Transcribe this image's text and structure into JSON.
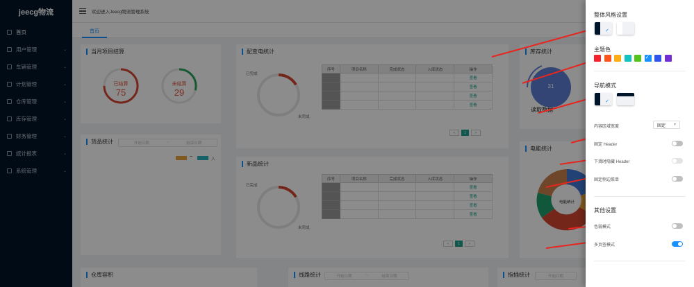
{
  "app": {
    "logo": "jeecg物流"
  },
  "header": {
    "welcome": "欢迎进入Jeecg物流管理系统"
  },
  "tabs": [
    {
      "label": "首页"
    }
  ],
  "sidebar": {
    "items": [
      {
        "label": "首页",
        "arrow": ""
      },
      {
        "label": "用户管理",
        "arrow": "⌄"
      },
      {
        "label": "车辆管理",
        "arrow": "⌄"
      },
      {
        "label": "计划管理",
        "arrow": "⌄"
      },
      {
        "label": "仓库管理",
        "arrow": "⌄"
      },
      {
        "label": "库存管理",
        "arrow": "⌄"
      },
      {
        "label": "财务管理",
        "arrow": "⌄"
      },
      {
        "label": "统计报表",
        "arrow": "⌄"
      },
      {
        "label": "系统管理",
        "arrow": "⌄"
      }
    ]
  },
  "dashboard": {
    "monthly": {
      "title": "当月项目结算",
      "settled_label": "已结算",
      "settled_value": "75",
      "unsettled_label": "未结算",
      "unsettled_value": "29"
    },
    "delivery": {
      "title": "配变电统计",
      "done_label": "已完成",
      "undone_label": "未完成",
      "columns": [
        "序号",
        "项目名称",
        "完成状态",
        "入库状态",
        "操作"
      ],
      "rows": [
        {
          "action": "查看"
        },
        {
          "action": "查看"
        },
        {
          "action": "查看"
        },
        {
          "action": "查看"
        }
      ],
      "pager": {
        "prev": "<",
        "current": "1",
        "next": ">"
      }
    },
    "products": {
      "title": "新品统计",
      "done_label": "已完成",
      "undone_label": "未完成",
      "columns": [
        "序号",
        "项目名称",
        "完成状态",
        "入库状态",
        "操作"
      ],
      "rows": [
        {
          "action": "查看"
        },
        {
          "action": "查看"
        },
        {
          "action": "查看"
        },
        {
          "action": "查看"
        }
      ],
      "pager": {
        "prev": "<",
        "current": "1",
        "next": ">"
      }
    },
    "goods": {
      "title": "货品统计",
      "start_placeholder": "开始日期",
      "sep": "~",
      "end_placeholder": "结束日期",
      "legend_letter": "入"
    },
    "stock": {
      "title": "库存统计",
      "center_value": "31",
      "sub_label": "读取数据"
    },
    "electric": {
      "title": "电能统计",
      "center_label": "电能统计"
    },
    "warehouse": {
      "title": "仓库容积"
    },
    "route": {
      "title": "线路统计",
      "start_placeholder": "开始日期",
      "sep": "~",
      "end_placeholder": "结束日期"
    },
    "position": {
      "title": "指插统计",
      "start_placeholder": "开始日期"
    }
  },
  "settings": {
    "theme_style_title": "整体风格设置",
    "theme_color_title": "主题色",
    "colors": [
      "#f5222d",
      "#fa541c",
      "#faad14",
      "#13c2c2",
      "#52c41a",
      "#1890ff",
      "#2f54eb",
      "#722ed1"
    ],
    "selected_color_index": 5,
    "nav_mode_title": "导航模式",
    "content_width_label": "内容区域宽度",
    "content_width_value": "固定",
    "fixed_header_label": "固定 Header",
    "hide_header_label": "下滑时隐藏 Header",
    "fixed_sidebar_label": "固定侧边菜单",
    "other_title": "其他设置",
    "weak_mode_label": "色弱模式",
    "multi_tab_label": "多页签模式",
    "switches": {
      "fixed_header": false,
      "hide_header": false,
      "fixed_sidebar": false,
      "weak_mode": false,
      "multi_tab": true
    },
    "check_glyph": "✓"
  },
  "colors": {
    "sidebar": "#001529",
    "accent": "#1890ff",
    "arrow": "#e8251f",
    "table_action": "#1e9e8e"
  }
}
